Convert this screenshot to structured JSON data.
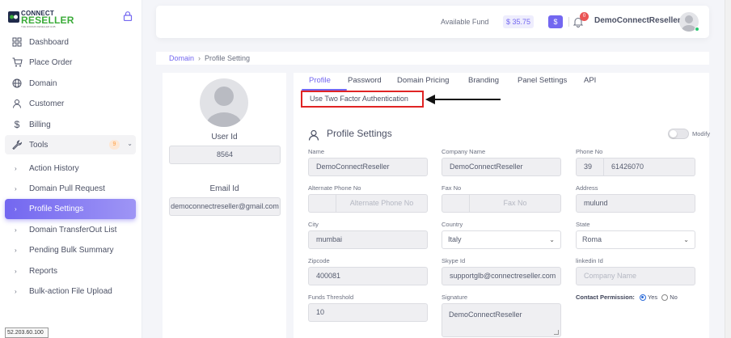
{
  "logo": {
    "connect": "CONNECT",
    "reseller": "RESELLER",
    "tagline": "THE DOMAIN RESELLER HUB"
  },
  "sidebar": {
    "items": [
      {
        "label": "Dashboard",
        "icon": "grid-icon"
      },
      {
        "label": "Place Order",
        "icon": "cart-icon"
      },
      {
        "label": "Domain",
        "icon": "globe-icon"
      },
      {
        "label": "Customer",
        "icon": "user-icon"
      },
      {
        "label": "Billing",
        "icon": "dollar-icon"
      },
      {
        "label": "Tools",
        "icon": "wrench-icon",
        "badge": "9"
      }
    ],
    "subitems": [
      {
        "label": "Action History"
      },
      {
        "label": "Domain Pull Request"
      },
      {
        "label": "Profile Settings",
        "active": true
      },
      {
        "label": "Domain TransferOut List"
      },
      {
        "label": "Pending Bulk Summary"
      },
      {
        "label": "Reports"
      },
      {
        "label": "Bulk-action File Upload"
      }
    ]
  },
  "status_bar": {
    "ip": "52.203.60.100"
  },
  "header": {
    "fund_label": "Available Fund",
    "fund_value": "$ 35.75",
    "dollar_button": "$",
    "notification_count": "0",
    "username": "DemoConnectReseller"
  },
  "breadcrumb": {
    "root": "Domain",
    "separator": "›",
    "current": "Profile Setting"
  },
  "profile_card": {
    "user_id_label": "User Id",
    "user_id": "8564",
    "email_label": "Email Id",
    "email": "democonnectreseller@gmail.com"
  },
  "tabs": [
    {
      "label": "Profile",
      "active": true
    },
    {
      "label": "Password"
    },
    {
      "label": "Domain Pricing"
    },
    {
      "label": "Branding"
    },
    {
      "label": "Panel Settings"
    },
    {
      "label": "API"
    }
  ],
  "two_factor_link": "Use Two Factor Authentication",
  "profile_settings": {
    "title": "Profile Settings",
    "modify_label": "Modify",
    "fields": {
      "name": {
        "label": "Name",
        "value": "DemoConnectReseller"
      },
      "company": {
        "label": "Company Name",
        "value": "DemoConnectReseller"
      },
      "phone": {
        "label": "Phone No",
        "code": "39",
        "value": "61426070"
      },
      "alt_phone": {
        "label": "Alternate Phone No",
        "code": "",
        "placeholder": "Alternate Phone No"
      },
      "fax": {
        "label": "Fax No",
        "code": "",
        "placeholder": "Fax No"
      },
      "address": {
        "label": "Address",
        "value": "mulund"
      },
      "city": {
        "label": "City",
        "value": "mumbai"
      },
      "country": {
        "label": "Country",
        "value": "Italy"
      },
      "state": {
        "label": "State",
        "value": "Roma"
      },
      "zipcode": {
        "label": "Zipcode",
        "value": "400081"
      },
      "skype": {
        "label": "Skype Id",
        "value": "supportglb@connectreseller.com"
      },
      "linkedin": {
        "label": "linkedin Id",
        "placeholder": "Company Name"
      },
      "funds": {
        "label": "Funds Threshold",
        "value": "10"
      },
      "signature": {
        "label": "Signature",
        "value": "DemoConnectReseller"
      }
    },
    "contact": {
      "label": "Contact Permission:",
      "yes": "Yes",
      "no": "No",
      "selected": "Yes"
    }
  },
  "colors": {
    "accent": "#7367f0",
    "brand_green": "#3bab39",
    "highlight_red": "#e02424"
  }
}
